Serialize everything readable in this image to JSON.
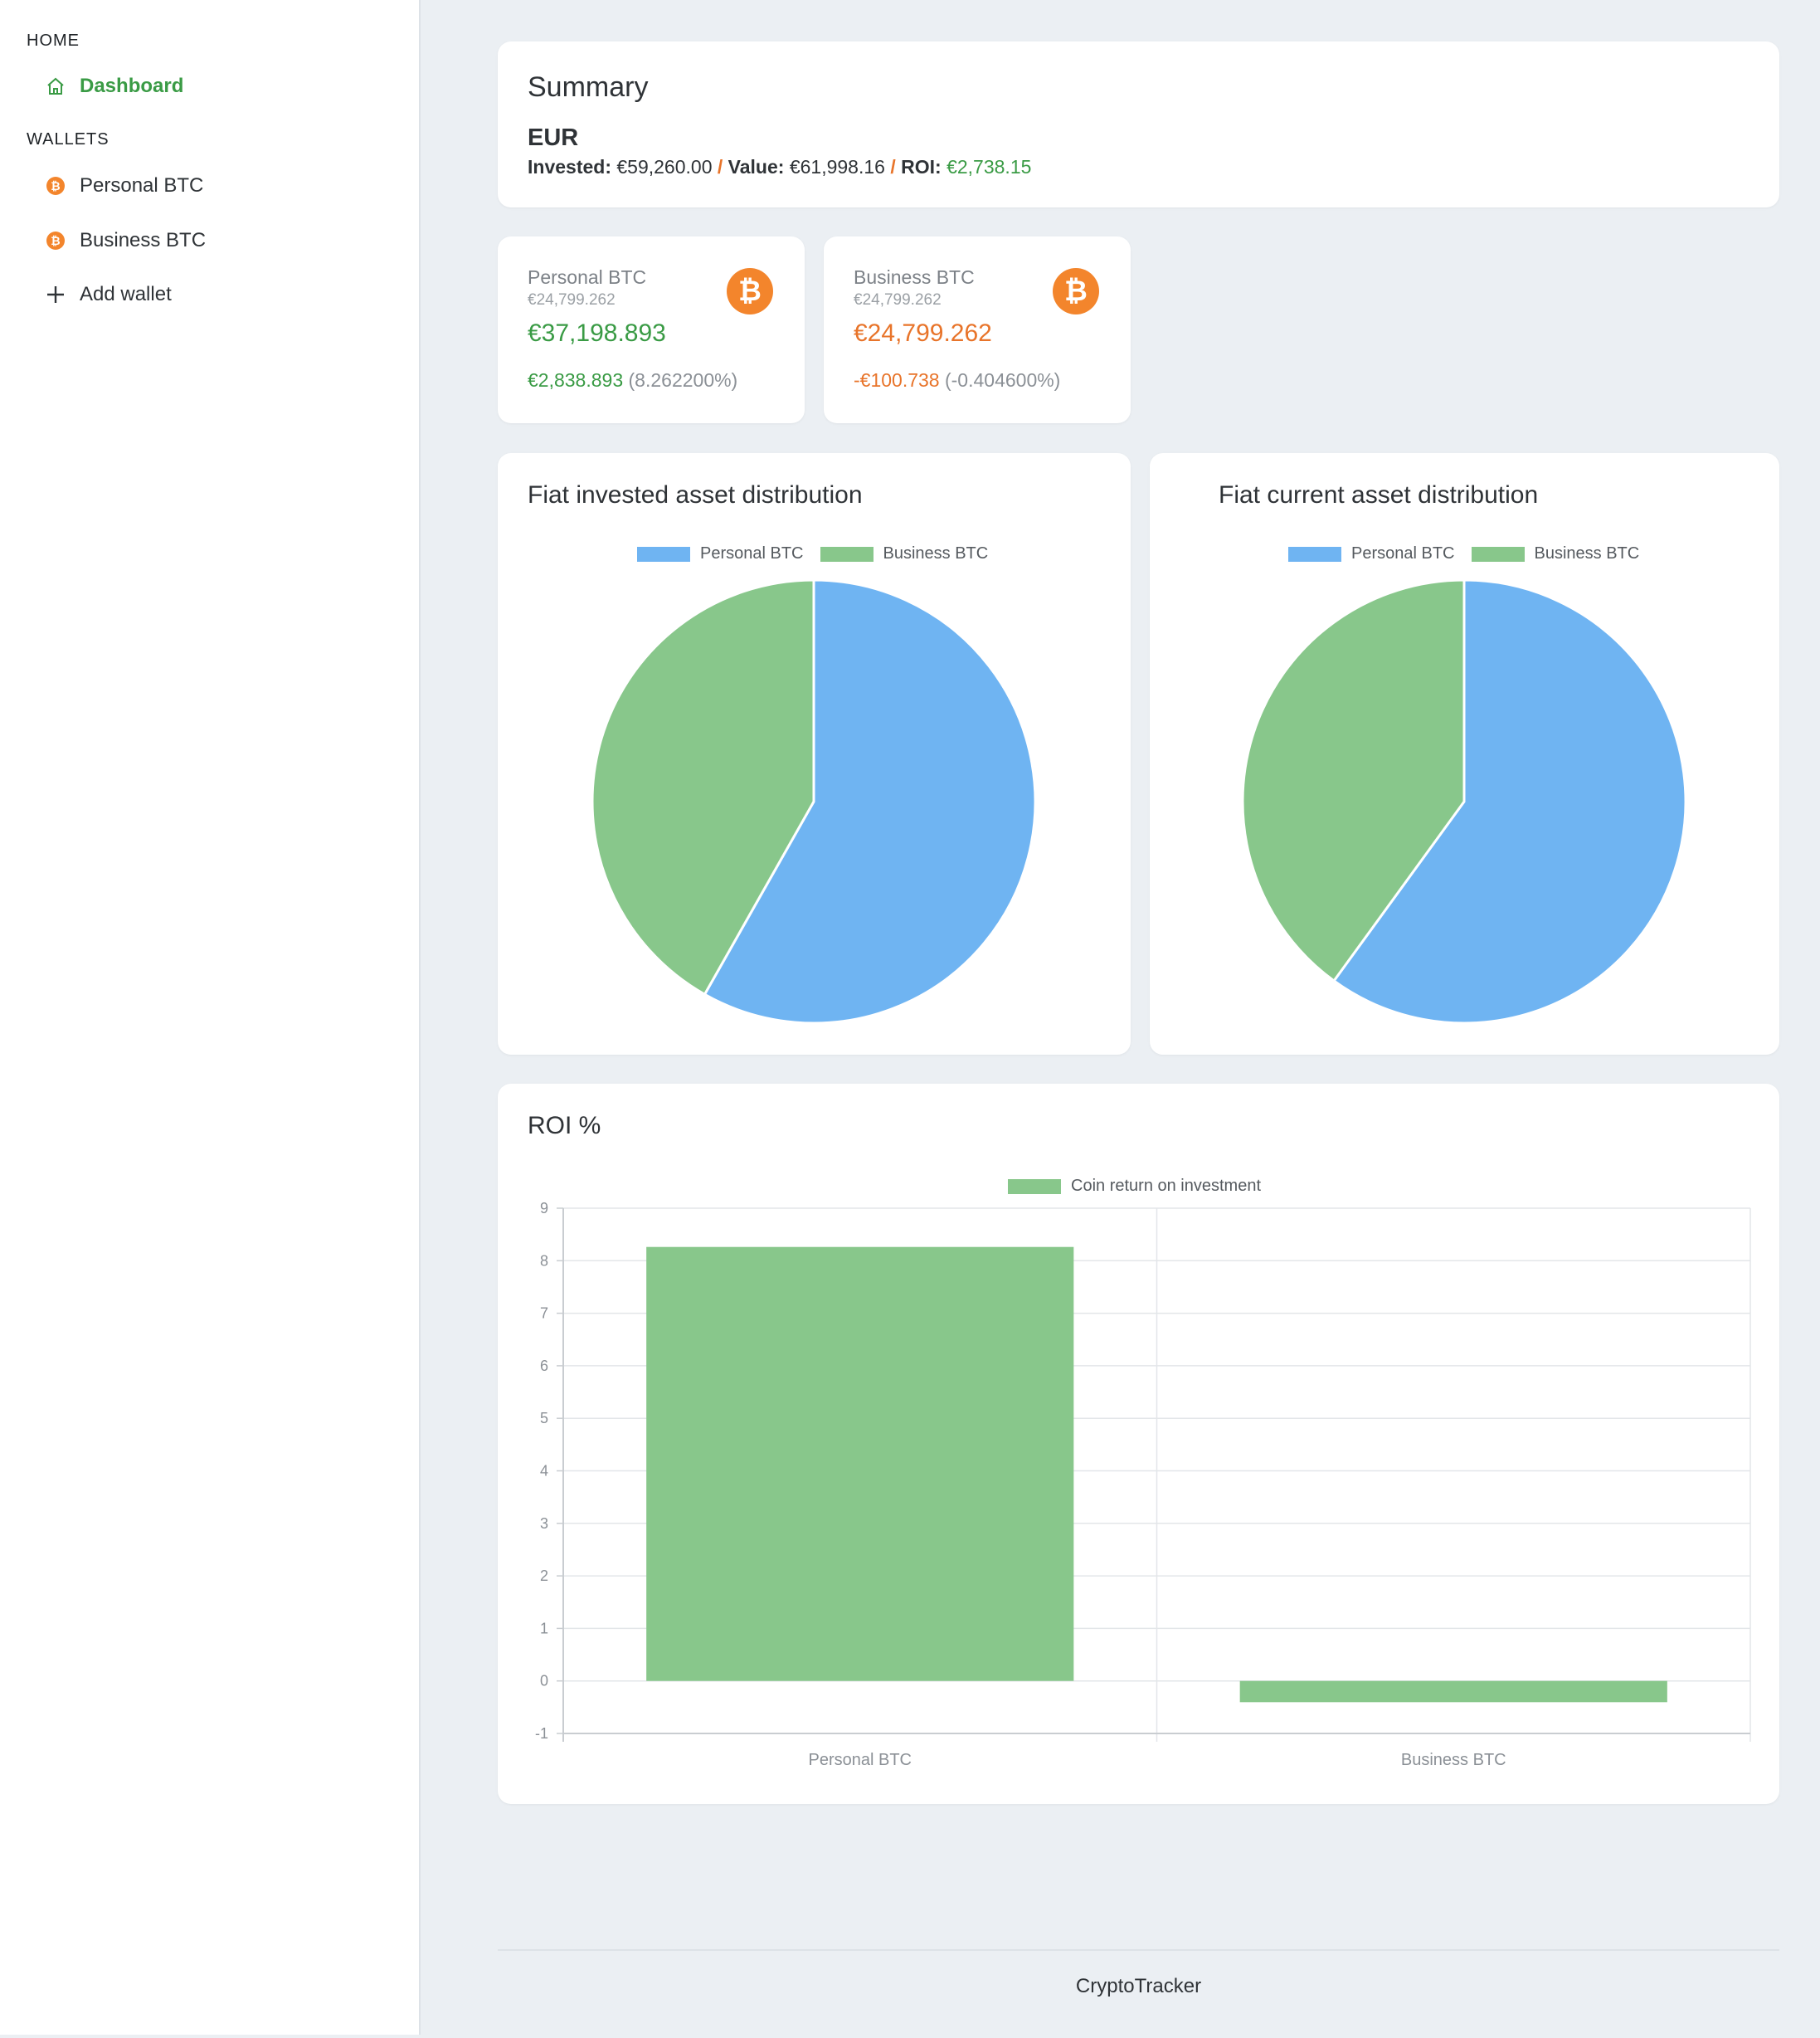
{
  "sidebar": {
    "home_heading": "HOME",
    "dashboard_label": "Dashboard",
    "wallets_heading": "WALLETS",
    "wallets": [
      {
        "label": "Personal BTC",
        "icon": "bitcoin-icon"
      },
      {
        "label": "Business BTC",
        "icon": "bitcoin-icon"
      }
    ],
    "add_wallet_label": "Add wallet"
  },
  "summary": {
    "title": "Summary",
    "currency": "EUR",
    "invested_label": "Invested:",
    "invested_value": "€59,260.00",
    "value_label": "Value:",
    "value_value": "€61,998.16",
    "roi_label": "ROI:",
    "roi_value": "€2,738.15",
    "separator": "/"
  },
  "wallet_cards": [
    {
      "name": "Personal BTC",
      "sub": "€24,799.262",
      "value": "€37,198.893",
      "roi_amount": "€2,838.893",
      "roi_percent": "(8.262200%)",
      "icon_glyph": "₿"
    },
    {
      "name": "Business BTC",
      "sub": "€24,799.262",
      "value": "€24,799.262",
      "roi_amount": "-€100.738",
      "roi_percent": "(-0.404600%)",
      "icon_glyph": "₿"
    }
  ],
  "colors": {
    "accent_green": "#3a9b45",
    "accent_orange": "#e8742a",
    "series_blue": "#6fb4f2",
    "series_green": "#88c78b"
  },
  "chart_data": [
    {
      "type": "pie",
      "title": "Fiat invested asset distribution",
      "labels": [
        "Personal BTC",
        "Business BTC"
      ],
      "values": [
        58.2,
        41.8
      ]
    },
    {
      "type": "pie",
      "title": "Fiat current asset distribution",
      "labels": [
        "Personal BTC",
        "Business BTC"
      ],
      "values": [
        60.0,
        40.0
      ]
    },
    {
      "type": "bar",
      "title": "ROI %",
      "categories": [
        "Personal BTC",
        "Business BTC"
      ],
      "series": [
        {
          "name": "Coin return on investment",
          "values": [
            8.2622,
            -0.4046
          ]
        }
      ],
      "ylim": [
        -1,
        9
      ],
      "yticks": [
        "9",
        "8",
        "7",
        "6",
        "5",
        "4",
        "3",
        "2",
        "1",
        "0",
        "-1"
      ],
      "grid": true,
      "legend": "top-center"
    }
  ],
  "footer": {
    "text": "CryptoTracker"
  }
}
